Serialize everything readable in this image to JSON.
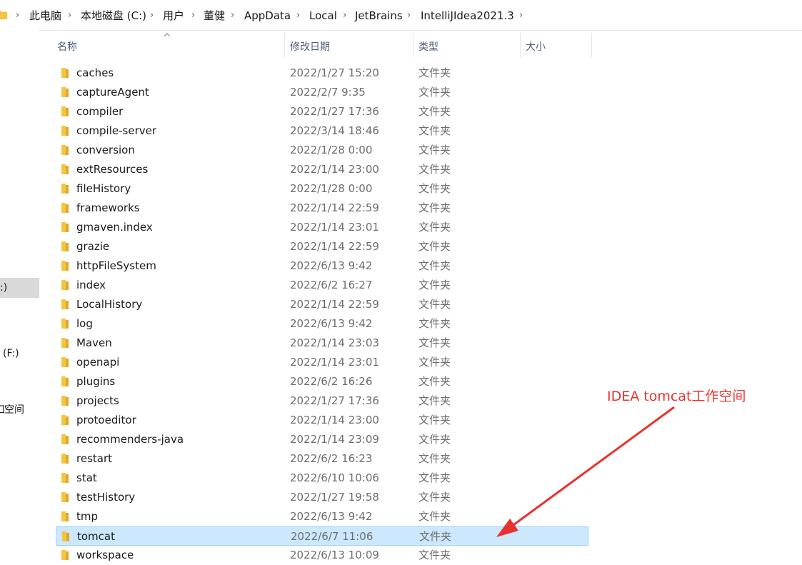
{
  "breadcrumb": [
    "此电脑",
    "本地磁盘 (C:)",
    "用户",
    "董健",
    "AppData",
    "Local",
    "JetBrains",
    "IntelliJIdea2021.3"
  ],
  "nav": {
    "items": [
      ":)",
      "(F:)",
      "空间"
    ]
  },
  "columns": {
    "name": "名称",
    "modified": "修改日期",
    "type": "类型",
    "size": "大小"
  },
  "files": [
    {
      "name": "caches",
      "date": "2022/1/27 15:20",
      "type": "文件夹"
    },
    {
      "name": "captureAgent",
      "date": "2022/2/7 9:35",
      "type": "文件夹"
    },
    {
      "name": "compiler",
      "date": "2022/1/27 17:36",
      "type": "文件夹"
    },
    {
      "name": "compile-server",
      "date": "2022/3/14 18:46",
      "type": "文件夹"
    },
    {
      "name": "conversion",
      "date": "2022/1/28 0:00",
      "type": "文件夹"
    },
    {
      "name": "extResources",
      "date": "2022/1/14 23:00",
      "type": "文件夹"
    },
    {
      "name": "fileHistory",
      "date": "2022/1/28 0:00",
      "type": "文件夹"
    },
    {
      "name": "frameworks",
      "date": "2022/1/14 22:59",
      "type": "文件夹"
    },
    {
      "name": "gmaven.index",
      "date": "2022/1/14 23:01",
      "type": "文件夹"
    },
    {
      "name": "grazie",
      "date": "2022/1/14 22:59",
      "type": "文件夹"
    },
    {
      "name": "httpFileSystem",
      "date": "2022/6/13 9:42",
      "type": "文件夹"
    },
    {
      "name": "index",
      "date": "2022/6/2 16:27",
      "type": "文件夹"
    },
    {
      "name": "LocalHistory",
      "date": "2022/1/14 22:59",
      "type": "文件夹"
    },
    {
      "name": "log",
      "date": "2022/6/13 9:42",
      "type": "文件夹"
    },
    {
      "name": "Maven",
      "date": "2022/1/14 23:03",
      "type": "文件夹"
    },
    {
      "name": "openapi",
      "date": "2022/1/14 23:01",
      "type": "文件夹"
    },
    {
      "name": "plugins",
      "date": "2022/6/2 16:26",
      "type": "文件夹"
    },
    {
      "name": "projects",
      "date": "2022/1/27 17:36",
      "type": "文件夹"
    },
    {
      "name": "protoeditor",
      "date": "2022/1/14 23:00",
      "type": "文件夹"
    },
    {
      "name": "recommenders-java",
      "date": "2022/1/14 23:09",
      "type": "文件夹"
    },
    {
      "name": "restart",
      "date": "2022/6/2 16:23",
      "type": "文件夹"
    },
    {
      "name": "stat",
      "date": "2022/6/10 10:06",
      "type": "文件夹"
    },
    {
      "name": "testHistory",
      "date": "2022/1/27 19:58",
      "type": "文件夹"
    },
    {
      "name": "tmp",
      "date": "2022/6/13 9:42",
      "type": "文件夹"
    },
    {
      "name": "tomcat",
      "date": "2022/6/7 11:06",
      "type": "文件夹",
      "selected": true
    },
    {
      "name": "workspace",
      "date": "2022/6/13 10:09",
      "type": "文件夹"
    }
  ],
  "annotation": {
    "text": "IDEA tomcat工作空间",
    "color": "#e8322f"
  },
  "colors": {
    "folder": "#f4c443",
    "selection": "#cce8ff",
    "selection_border": "#99d1ff"
  },
  "icons": {
    "folder": "folder-icon",
    "chevron": "chevron-right-icon",
    "sort": "sort-ascending-icon"
  }
}
